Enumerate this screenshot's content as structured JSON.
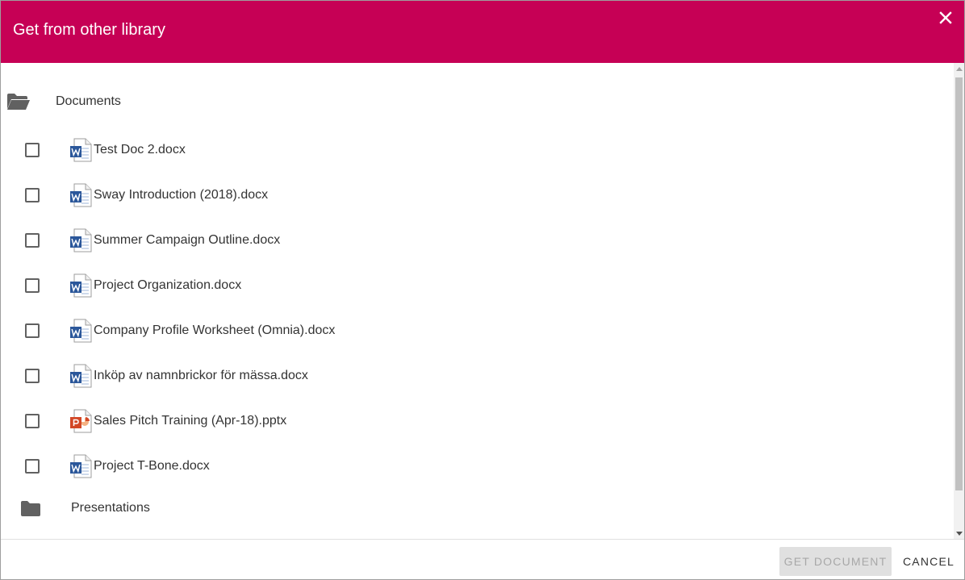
{
  "dialog": {
    "title": "Get from other library",
    "close_icon": "close-icon"
  },
  "folders": [
    {
      "label": "Documents",
      "icon": "folder-open-icon",
      "state": "open"
    },
    {
      "label": "Presentations",
      "icon": "folder-icon",
      "state": "closed"
    }
  ],
  "files": [
    {
      "name": "Test Doc 2.docx",
      "type": "word",
      "checked": false
    },
    {
      "name": "Sway Introduction (2018).docx",
      "type": "word",
      "checked": false
    },
    {
      "name": "Summer Campaign Outline.docx",
      "type": "word",
      "checked": false
    },
    {
      "name": "Project Organization.docx",
      "type": "word",
      "checked": false
    },
    {
      "name": "Company Profile Worksheet (Omnia).docx",
      "type": "word",
      "checked": false
    },
    {
      "name": "Inköp av namnbrickor för mässa.docx",
      "type": "word",
      "checked": false
    },
    {
      "name": "Sales Pitch Training (Apr-18).pptx",
      "type": "powerpoint",
      "checked": false
    },
    {
      "name": "Project T-Bone.docx",
      "type": "word",
      "checked": false
    }
  ],
  "footer": {
    "get_document_label": "GET DOCUMENT",
    "get_document_enabled": false,
    "cancel_label": "CANCEL"
  },
  "colors": {
    "header": "#c60055",
    "word": "#2b579a",
    "powerpoint": "#d24726",
    "folder": "#616161"
  }
}
